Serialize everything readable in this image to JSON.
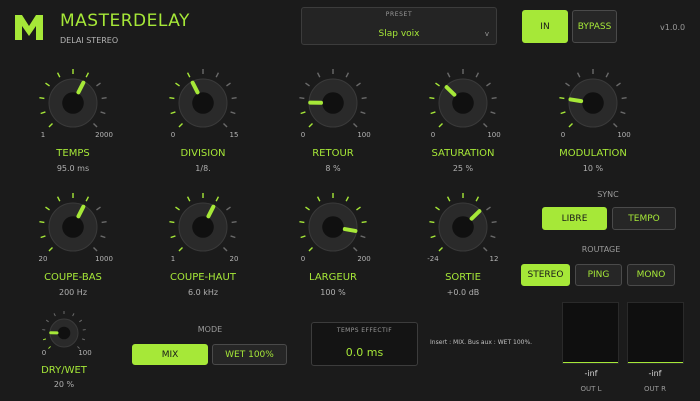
{
  "header": {
    "logo_icon": "m-logo-icon",
    "title": "MASTERDELAY",
    "subtitle": "DELAI STEREO",
    "version": "v1.0.0"
  },
  "preset": {
    "label": "PRESET",
    "value": "Slap voix",
    "chevron": "v"
  },
  "power": {
    "in_label": "IN",
    "bypass_label": "BYPASS",
    "active": "IN"
  },
  "knobs": {
    "temps": {
      "name": "TEMPS",
      "value": "95.0 ms",
      "min": "1",
      "max": "2000",
      "level": 0.6
    },
    "division": {
      "name": "DIVISION",
      "value": "1/8.",
      "min": "0",
      "max": "15",
      "level": 0.4
    },
    "retour": {
      "name": "RETOUR",
      "value": "8 %",
      "min": "0",
      "max": "100",
      "level": 0.17
    },
    "saturation": {
      "name": "SATURATION",
      "value": "25 %",
      "min": "0",
      "max": "100",
      "level": 0.33
    },
    "modulation": {
      "name": "MODULATION",
      "value": "10 %",
      "min": "0",
      "max": "100",
      "level": 0.2
    },
    "coupe_bas": {
      "name": "COUPE-BAS",
      "value": "200 Hz",
      "min": "20",
      "max": "1000",
      "level": 0.6
    },
    "coupe_haut": {
      "name": "COUPE-HAUT",
      "value": "6.0 kHz",
      "min": "1",
      "max": "20",
      "level": 0.6
    },
    "largeur": {
      "name": "LARGEUR",
      "value": "100 %",
      "min": "0",
      "max": "200",
      "level": 0.87
    },
    "sortie": {
      "name": "SORTIE",
      "value": "+0.0 dB",
      "min": "-24",
      "max": "12",
      "level": 0.67
    },
    "dry_wet": {
      "name": "DRY/WET",
      "value": "20 %",
      "min": "0",
      "max": "100",
      "level": 0.17
    }
  },
  "sync": {
    "label": "SYNC",
    "options": [
      "LIBRE",
      "TEMPO"
    ],
    "active": "LIBRE"
  },
  "routing": {
    "label": "ROUTAGE",
    "options": [
      "STEREO",
      "PING",
      "MONO"
    ],
    "active": "STEREO"
  },
  "mode": {
    "label": "MODE",
    "options": [
      "MIX",
      "WET 100%"
    ],
    "active": "MIX"
  },
  "effective_time": {
    "label": "TEMPS EFFECTIF",
    "value": "0.0 ms"
  },
  "note": "Insert : MIX. Bus aux : WET 100%.",
  "meters": {
    "left": {
      "value": "-inf",
      "label": "OUT L",
      "level": 0.02
    },
    "right": {
      "value": "-inf",
      "label": "OUT R",
      "level": 0.02
    }
  },
  "colors": {
    "accent": "#a6e838",
    "background": "#1b1b1b",
    "knob_body": "#2a2a2a"
  }
}
